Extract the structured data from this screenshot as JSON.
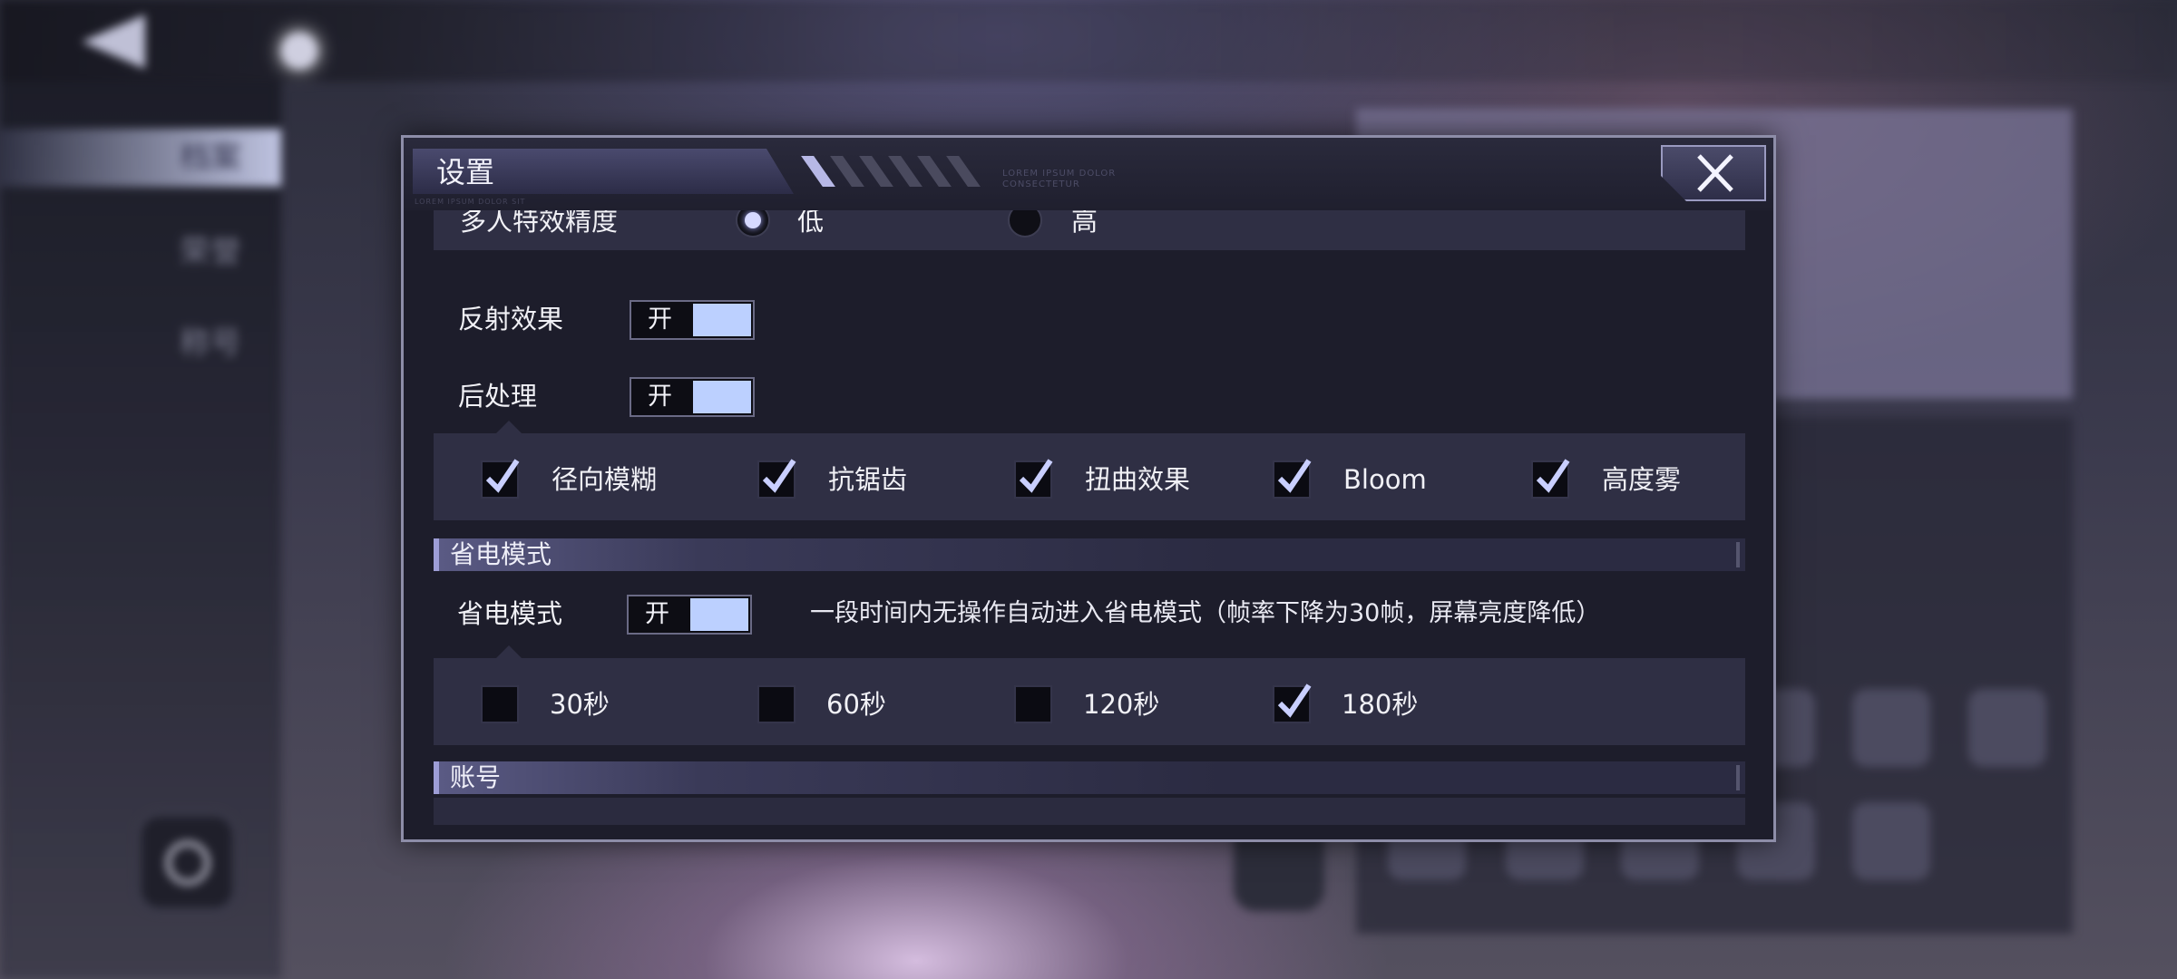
{
  "background": {
    "nav": [
      "档案",
      "荣誉",
      "称号"
    ]
  },
  "dialog": {
    "title": "设置",
    "deco_text_1": "LOREM IPSUM DOLOR",
    "deco_text_2": "CONSECTETUR",
    "deco_text_3": "LOREM IPSUM DOLOR SIT"
  },
  "multiplayer_effect": {
    "label": "多人特效精度",
    "options": [
      {
        "label": "低",
        "selected": true
      },
      {
        "label": "高",
        "selected": false
      }
    ]
  },
  "reflection": {
    "label": "反射效果",
    "toggle": "开",
    "on": true
  },
  "postprocess": {
    "label": "后处理",
    "toggle": "开",
    "on": true,
    "options": [
      {
        "label": "径向模糊",
        "checked": true
      },
      {
        "label": "抗锯齿",
        "checked": true
      },
      {
        "label": "扭曲效果",
        "checked": true
      },
      {
        "label": "Bloom",
        "checked": true
      },
      {
        "label": "高度雾",
        "checked": true
      }
    ]
  },
  "power_saving_section": {
    "title": "省电模式"
  },
  "power_saving": {
    "label": "省电模式",
    "toggle": "开",
    "on": true,
    "description": "一段时间内无操作自动进入省电模式（帧率下降为30帧，屏幕亮度降低）",
    "options": [
      {
        "label": "30秒",
        "checked": false
      },
      {
        "label": "60秒",
        "checked": false
      },
      {
        "label": "120秒",
        "checked": false
      },
      {
        "label": "180秒",
        "checked": true
      }
    ]
  },
  "account_section": {
    "title": "账号"
  },
  "colors": {
    "accent": "#bcd0ff",
    "panel": "#1d1d2b",
    "row": "#2f2f44",
    "frame": "#8d8da8"
  }
}
